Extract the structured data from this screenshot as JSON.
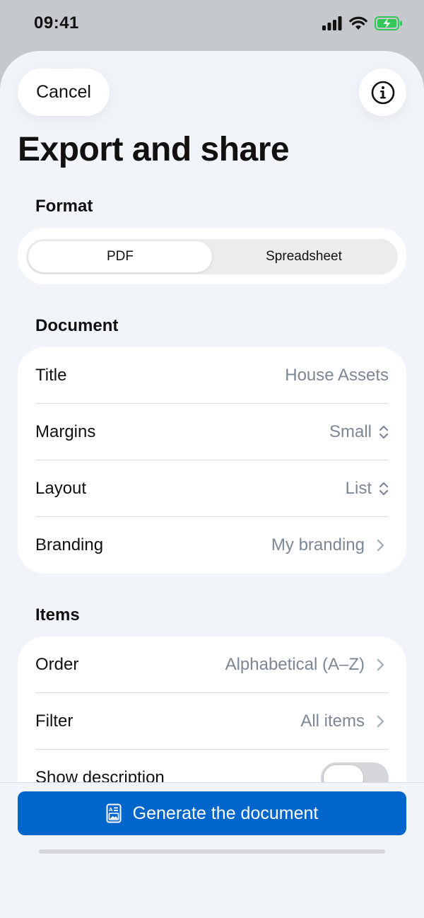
{
  "status_bar": {
    "time": "09:41"
  },
  "header": {
    "cancel_label": "Cancel",
    "title": "Export and share"
  },
  "format": {
    "section_label": "Format",
    "options": [
      "PDF",
      "Spreadsheet"
    ],
    "selected": "PDF"
  },
  "document": {
    "section_label": "Document",
    "rows": [
      {
        "label": "Title",
        "value": "House Assets"
      },
      {
        "label": "Margins",
        "value": "Small"
      },
      {
        "label": "Layout",
        "value": "List"
      },
      {
        "label": "Branding",
        "value": "My branding"
      }
    ]
  },
  "items": {
    "section_label": "Items",
    "rows": [
      {
        "label": "Order",
        "value": "Alphabetical (A–Z)"
      },
      {
        "label": "Filter",
        "value": "All items"
      },
      {
        "label": "Show description",
        "value": ""
      }
    ]
  },
  "footer": {
    "generate_label": "Generate the document"
  },
  "colors": {
    "accent": "#0066cc",
    "background": "#f1f4f9",
    "secondary_text": "#7d8794"
  }
}
